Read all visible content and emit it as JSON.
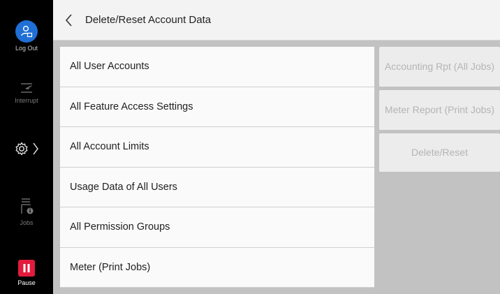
{
  "rail": {
    "logout_label": "Log Out",
    "interrupt_label": "Interrupt",
    "jobs_label": "Jobs",
    "pause_label": "Pause",
    "colors": {
      "logout": "#1f6fd6",
      "pause": "#e21b3c"
    }
  },
  "header": {
    "title": "Delete/Reset Account Data"
  },
  "list": {
    "items": [
      {
        "label": "All User Accounts"
      },
      {
        "label": "All Feature Access Settings"
      },
      {
        "label": "All Account Limits"
      },
      {
        "label": "Usage Data of All Users"
      },
      {
        "label": "All Permission Groups"
      },
      {
        "label": "Meter (Print Jobs)"
      }
    ]
  },
  "side": {
    "accounting_report": "Accounting Rpt (All Jobs)",
    "meter_report": "Meter Report (Print Jobs)",
    "delete_reset": "Delete/Reset"
  }
}
